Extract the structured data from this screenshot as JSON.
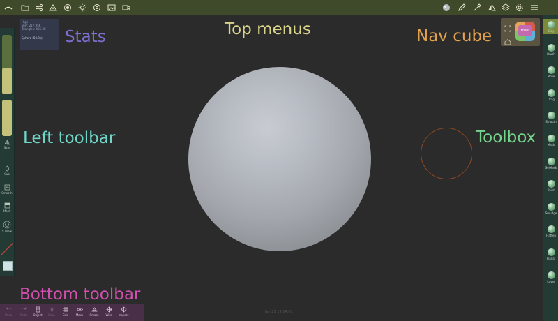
{
  "top_menus": {
    "left_icons": [
      "logo-icon",
      "folder-icon",
      "share-icon",
      "scene-icon",
      "globe-icon",
      "sun-icon",
      "target-icon",
      "image-icon",
      "video-icon"
    ],
    "right_icons": [
      "material-icon",
      "pen-icon",
      "picker-icon",
      "symmetry-icon",
      "layers-icon",
      "settings-icon",
      "menu-icon"
    ]
  },
  "stats": {
    "line1": "High",
    "line2": "Vert: 217.95K",
    "line3": "Triangles: 435.2K",
    "object": "Sphere (50.3k)"
  },
  "annotations": {
    "stats": "Stats",
    "top_menus": "Top menus",
    "nav_cube": "Nav cube",
    "left_toolbar": "Left toolbar",
    "toolbox": "Toolbox",
    "bottom_toolbar": "Bottom toolbar",
    "colors": {
      "stats": "#7b6fd0",
      "top_menus": "#d8d48a",
      "nav_cube": "#e3a24e",
      "left_toolbar": "#6fd6c8",
      "toolbox": "#74d48c",
      "bottom_toolbar": "#d24fb0"
    }
  },
  "left_toolbar": {
    "radius_fill": 0.45,
    "intensity_fill": 1.0,
    "tools": [
      {
        "label": "Sym"
      },
      {
        "label": "Sub"
      },
      {
        "label": "Smooth"
      },
      {
        "label": "Mask"
      },
      {
        "label": "S.Draw"
      }
    ]
  },
  "navcube": {
    "front_label": "Front"
  },
  "toolbox": {
    "tools": [
      "Clay",
      "Brush",
      "Move",
      "Drag",
      "Smooth",
      "Mask",
      "SelMask",
      "Paint",
      "Smudge",
      "Flatten",
      "Planar",
      "Layer"
    ]
  },
  "bottom_toolbar": {
    "items": [
      {
        "label": "Undo",
        "icon": "undo-icon",
        "dim": true
      },
      {
        "label": "Redo",
        "icon": "redo-icon",
        "dim": true
      },
      {
        "label": "Object",
        "icon": "object-icon",
        "dim": false
      },
      {
        "label": "Snap",
        "icon": "snap-icon",
        "dim": true
      },
      {
        "label": "Grid",
        "icon": "grid-icon",
        "dim": false
      },
      {
        "label": "Mask",
        "icon": "eye-icon",
        "dim": false
      },
      {
        "label": "Smoot",
        "icon": "smooth-icon",
        "dim": false
      },
      {
        "label": "Wire",
        "icon": "wire-icon",
        "dim": false
      },
      {
        "label": "Inspect",
        "icon": "inspect-icon",
        "dim": false
      }
    ],
    "status": "Jan 25 19:54:01"
  }
}
